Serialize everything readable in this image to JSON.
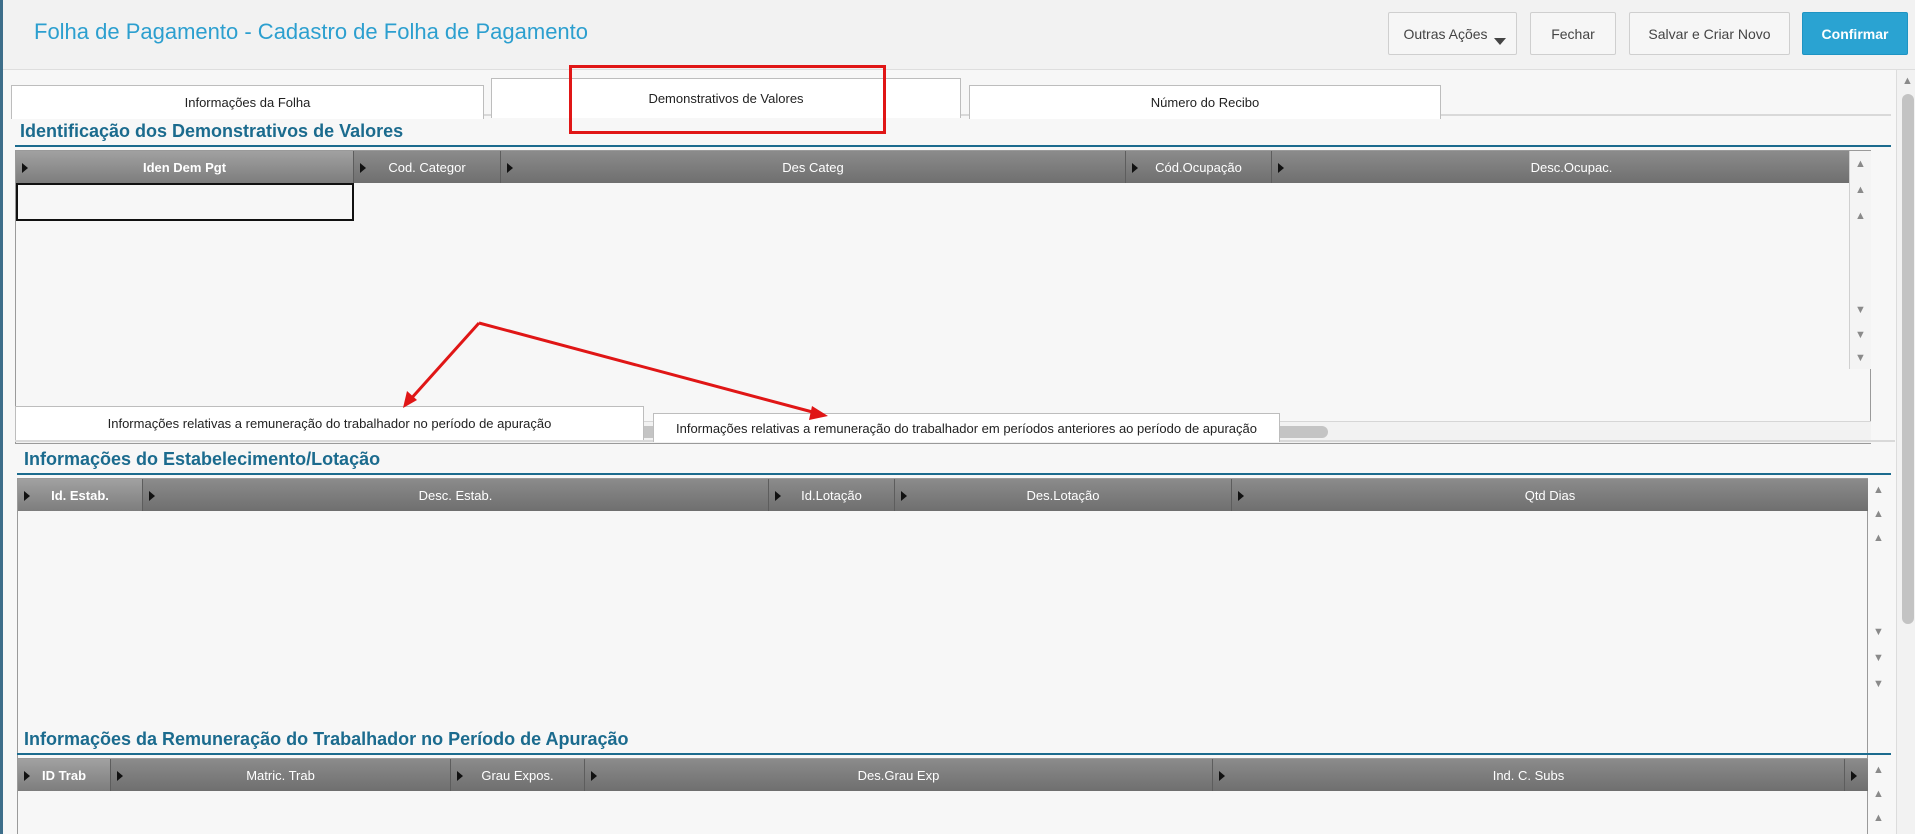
{
  "header": {
    "title": "Folha de Pagamento - Cadastro de Folha de Pagamento",
    "buttons": {
      "other_actions": "Outras Ações",
      "close": "Fechar",
      "save_new": "Salvar e Criar Novo",
      "confirm": "Confirmar"
    }
  },
  "main_tabs": [
    {
      "label": "Informações da Folha"
    },
    {
      "label": "Demonstrativos de Valores"
    },
    {
      "label": "Número do Recibo"
    }
  ],
  "section1": {
    "title": "Identificação dos Demonstrativos de Valores",
    "columns": [
      "Iden Dem Pgt",
      "Cod. Categor",
      "Des Categ",
      "Cód.Ocupação",
      "Desc.Ocupac."
    ]
  },
  "sub_tabs": [
    {
      "label": "Informações relativas a remuneração do trabalhador no período de apuração"
    },
    {
      "label": "Informações relativas a remuneração do trabalhador em períodos anteriores ao período de apuração"
    }
  ],
  "section2": {
    "title": "Informações do Estabelecimento/Lotação",
    "columns": [
      "Id. Estab.",
      "Desc. Estab.",
      "Id.Lotação",
      "Des.Lotação",
      "Qtd Dias"
    ]
  },
  "section3": {
    "title": "Informações da Remuneração do Trabalhador no Período de Apuração",
    "columns": [
      "ID Trab",
      "Matric. Trab",
      "Grau Expos.",
      "Des.Grau Exp",
      "Ind. C. Subs"
    ]
  },
  "colors": {
    "accent": "#2aa3d2",
    "section_title": "#1b6b8e",
    "annotation": "#e01616"
  },
  "icons": {
    "dropdown": "chevron-down-icon",
    "column_marker": "triangle-right-icon",
    "scroll_top": "double-up-icon",
    "scroll_up": "arrow-up-icon",
    "scroll_down": "arrow-down-icon",
    "scroll_bottom": "double-down-icon"
  }
}
